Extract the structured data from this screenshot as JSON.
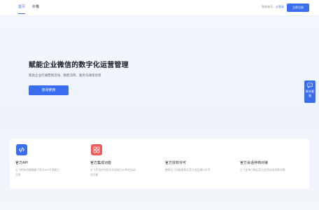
{
  "nav": {
    "home": "首页",
    "pricing": "价格",
    "login_prefix": "我有账号，去",
    "login_link": "登录",
    "register": "立即注册"
  },
  "hero": {
    "title": "赋能企业微信的数字化运营管理",
    "subtitle": "帮助企业打通营销活动、销售流转、服务沟通等场景",
    "cta": "咨询使用"
  },
  "contact": {
    "label": "联系客服",
    "icon": "chat-bubble-icon"
  },
  "features": [
    {
      "title": "官方API",
      "desc": "企飞所有功能都基于官方API开发能力开发",
      "icon": "code-icon",
      "color": "#3b6df0"
    },
    {
      "title": "官方集成功能",
      "desc": "企飞不含任何官方开发能力以外的自动化功能",
      "icon": "apps-grid-icon",
      "color": "#ef5b5b"
    },
    {
      "title": "官方授权许可",
      "desc": "使用企飞功能需购买官方会话接口许可",
      "icon": "",
      "color": ""
    },
    {
      "title": "官方会话存档对接",
      "desc": "企飞支持已购买官方会话存档消息对接",
      "icon": "",
      "color": ""
    }
  ],
  "colors": {
    "accent": "#3b6df0",
    "danger": "#ef5b5b"
  }
}
